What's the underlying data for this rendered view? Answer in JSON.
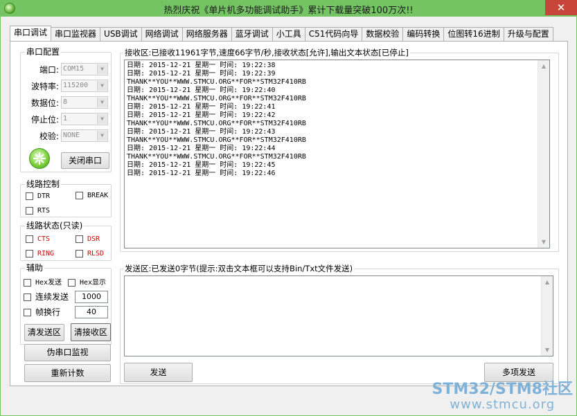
{
  "window": {
    "title": "热烈庆祝《单片机多功能调试助手》累计下载量突破100万次!!",
    "close_glyph": "✕"
  },
  "tabs": [
    {
      "label": "串口调试",
      "active": true
    },
    {
      "label": "串口监视器"
    },
    {
      "label": "USB调试"
    },
    {
      "label": "网络调试"
    },
    {
      "label": "网络服务器"
    },
    {
      "label": "蓝牙调试"
    },
    {
      "label": "小工具"
    },
    {
      "label": "C51代码向导"
    },
    {
      "label": "数据校验"
    },
    {
      "label": "编码转换"
    },
    {
      "label": "位图转16进制"
    },
    {
      "label": "升级与配置"
    }
  ],
  "serial_config": {
    "title": "串口配置",
    "port_label": "端口:",
    "port_value": "COM15",
    "baud_label": "波特率:",
    "baud_value": "115200",
    "databits_label": "数据位:",
    "databits_value": "8",
    "stopbits_label": "停止位:",
    "stopbits_value": "1",
    "parity_label": "校验:",
    "parity_value": "NONE",
    "close_port_label": "关闭串口"
  },
  "line_control": {
    "title": "线路控制",
    "dtr": "DTR",
    "break": "BREAK",
    "rts": "RTS"
  },
  "line_status": {
    "title": "线路状态(只读)",
    "cts": "CTS",
    "dsr": "DSR",
    "ring": "RING",
    "rlsd": "RLSD"
  },
  "assist": {
    "title": "辅助",
    "hex_send": "Hex发送",
    "hex_display": "Hex显示",
    "continuous_send": "连续发送",
    "interval_value": "1000",
    "frame_break": "帧换行",
    "frame_value": "40",
    "clear_send": "清发送区",
    "clear_recv": "清接收区",
    "fake_monitor": "伪串口监视",
    "recount": "重新计数"
  },
  "receive": {
    "title": "接收区:已接收11961字节,速度66字节/秒,接收状态[允许],输出文本状态[已停止]",
    "lines": [
      "日期: 2015-12-21 星期一 时间: 19:22:38",
      "日期: 2015-12-21 星期一 时间: 19:22:39",
      "THANK**YOU**WWW.STMCU.ORG**FOR**STM32F410RB",
      "日期: 2015-12-21 星期一 时间: 19:22:40",
      "THANK**YOU**WWW.STMCU.ORG**FOR**STM32F410RB",
      "日期: 2015-12-21 星期一 时间: 19:22:41",
      "日期: 2015-12-21 星期一 时间: 19:22:42",
      "THANK**YOU**WWW.STMCU.ORG**FOR**STM32F410RB",
      "日期: 2015-12-21 星期一 时间: 19:22:43",
      "THANK**YOU**WWW.STMCU.ORG**FOR**STM32F410RB",
      "日期: 2015-12-21 星期一 时间: 19:22:44",
      "THANK**YOU**WWW.STMCU.ORG**FOR**STM32F410RB",
      "日期: 2015-12-21 星期一 时间: 19:22:45",
      "日期: 2015-12-21 星期一 时间: 19:22:46"
    ]
  },
  "send": {
    "title": "发送区:已发送0字节(提示:双击文本框可以支持Bin/Txt文件发送)",
    "send_label": "发送",
    "multi_send_label": "多项发送"
  },
  "watermark": {
    "line1": "STM32/STM8社区",
    "line2": "www.stmcu.org"
  }
}
